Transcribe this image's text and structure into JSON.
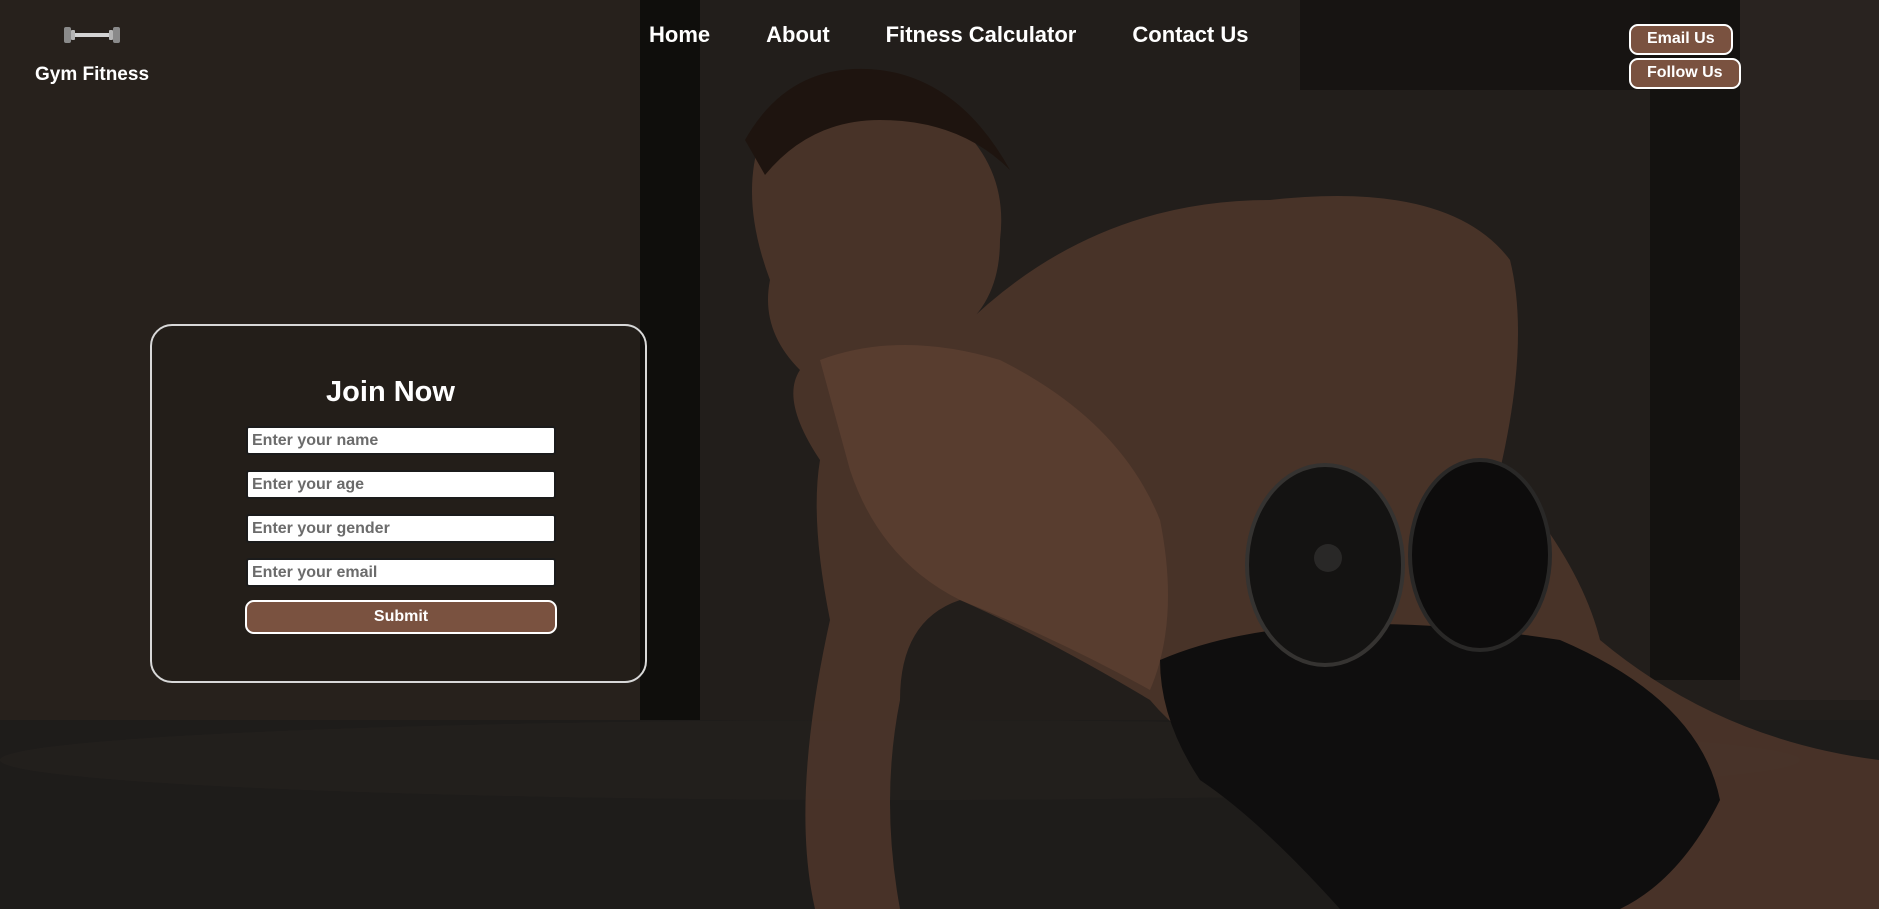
{
  "brand": {
    "name": "Gym Fitness",
    "logo_icon": "dumbbell-icon"
  },
  "nav": {
    "items": [
      "Home",
      "About",
      "Fitness Calculator",
      "Contact Us"
    ]
  },
  "contact": {
    "email_label": "Email Us",
    "follow_label": "Follow Us"
  },
  "form": {
    "title": "Join Now",
    "fields": [
      {
        "placeholder": "Enter your name",
        "value": ""
      },
      {
        "placeholder": "Enter your age",
        "value": ""
      },
      {
        "placeholder": "Enter your gender",
        "value": ""
      },
      {
        "placeholder": "Enter your email",
        "value": ""
      }
    ],
    "submit_label": "Submit"
  },
  "colors": {
    "accent": "#7a5240",
    "text": "#ffffff",
    "card_border": "#d8d8d8"
  }
}
